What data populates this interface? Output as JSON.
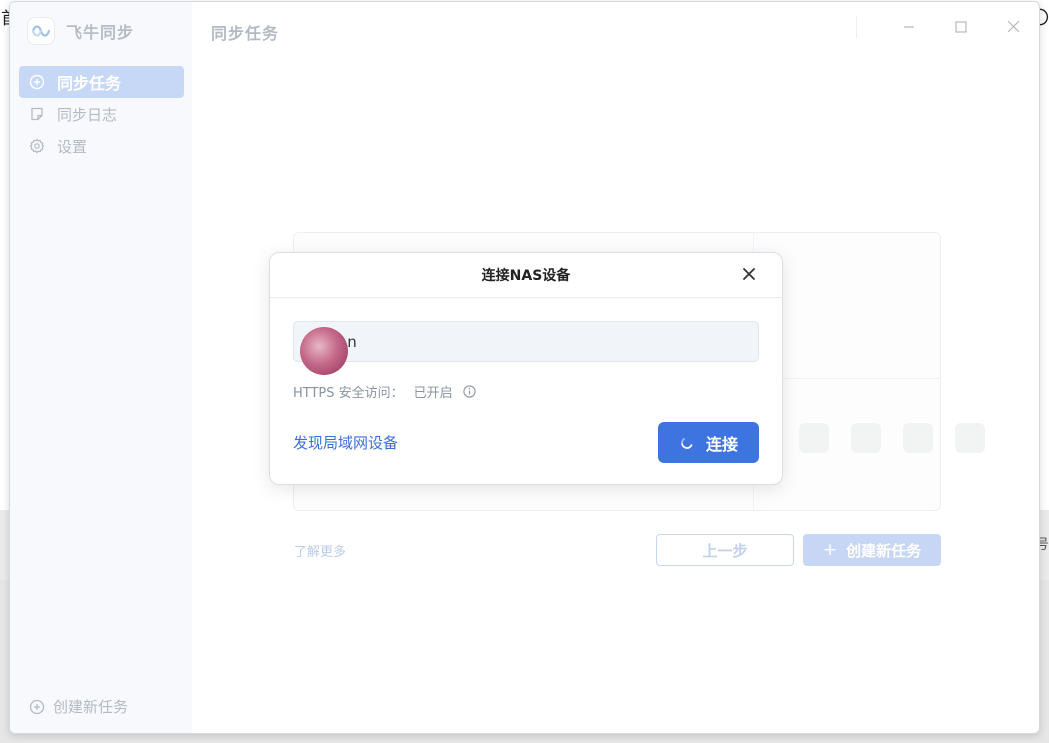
{
  "desktop": {
    "left_glyph": "首",
    "right_glyph": "〇",
    "mid_glyph": "号"
  },
  "app": {
    "brand_name": "飞牛同步",
    "page_title": "同步任务"
  },
  "sidebar": {
    "items": [
      {
        "label": "同步任务",
        "icon": "plus-circle-icon",
        "active": true
      },
      {
        "label": "同步日志",
        "icon": "note-icon",
        "active": false
      },
      {
        "label": "设置",
        "icon": "gear-icon",
        "active": false
      }
    ],
    "create_label": "创建新任务"
  },
  "wizard": {
    "learn_more": "了解更多",
    "prev_label": "上一步",
    "create_label": "创建新任务"
  },
  "modal": {
    "title": "连接NAS设备",
    "host_value": "an",
    "https_label": "HTTPS 安全访问：",
    "https_value": "已开启",
    "discover_label": "发现局域网设备",
    "connect_label": "连接"
  },
  "colors": {
    "accent": "#3e74e0",
    "sidebar_active": "#c7d8f6",
    "link": "#3b6fd9"
  }
}
